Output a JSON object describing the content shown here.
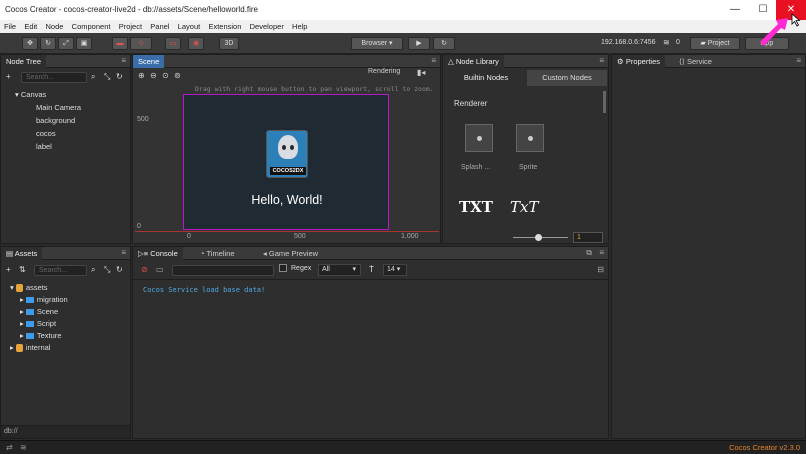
{
  "window": {
    "title": "Cocos Creator - cocos-creator-live2d - db://assets/Scene/helloworld.fire",
    "min": "—",
    "max": "☐",
    "close": "✕"
  },
  "menu": [
    "File",
    "Edit",
    "Node",
    "Component",
    "Project",
    "Panel",
    "Layout",
    "Extension",
    "Developer",
    "Help"
  ],
  "toolbar": {
    "mode_3d": "3D",
    "browser": "Browser",
    "ip": "192.168.0.6:7456",
    "wifi_count": "0",
    "project": "Project",
    "app": "App"
  },
  "node_tree": {
    "tab": "Node Tree",
    "search_placeholder": "Search...",
    "items": [
      "Canvas",
      "Main Camera",
      "background",
      "cocos",
      "label"
    ]
  },
  "scene": {
    "tab": "Scene",
    "rendering": "Rendering",
    "hint": "Drag with right mouse button to pan viewport, scroll to zoom.",
    "axis_y": [
      "500",
      "0"
    ],
    "axis_x": [
      "0",
      "500",
      "1,000"
    ],
    "logo_text": "COCOS2DX",
    "hello": "Hello, World!"
  },
  "node_library": {
    "tab": "Node Library",
    "builtin": "Builtin Nodes",
    "custom": "Custom Nodes",
    "section": "Renderer",
    "items": [
      "Splash ...",
      "Sprite"
    ],
    "txt1": "TXT",
    "txt2": "TxT",
    "slider_value": "1"
  },
  "properties": {
    "tab": "Properties",
    "service": "Service"
  },
  "assets": {
    "tab": "Assets",
    "search_placeholder": "Search...",
    "root": "assets",
    "children": [
      "migration",
      "Scene",
      "Script",
      "Texture"
    ],
    "internal": "internal",
    "path": "db://"
  },
  "console": {
    "tabs": [
      "Console",
      "Timeline",
      "Game Preview"
    ],
    "regex": "Regex",
    "filter": "All",
    "font_size": "14",
    "log": "Cocos Service load base data!"
  },
  "status": {
    "version": "Cocos Creator v2.3.0"
  }
}
